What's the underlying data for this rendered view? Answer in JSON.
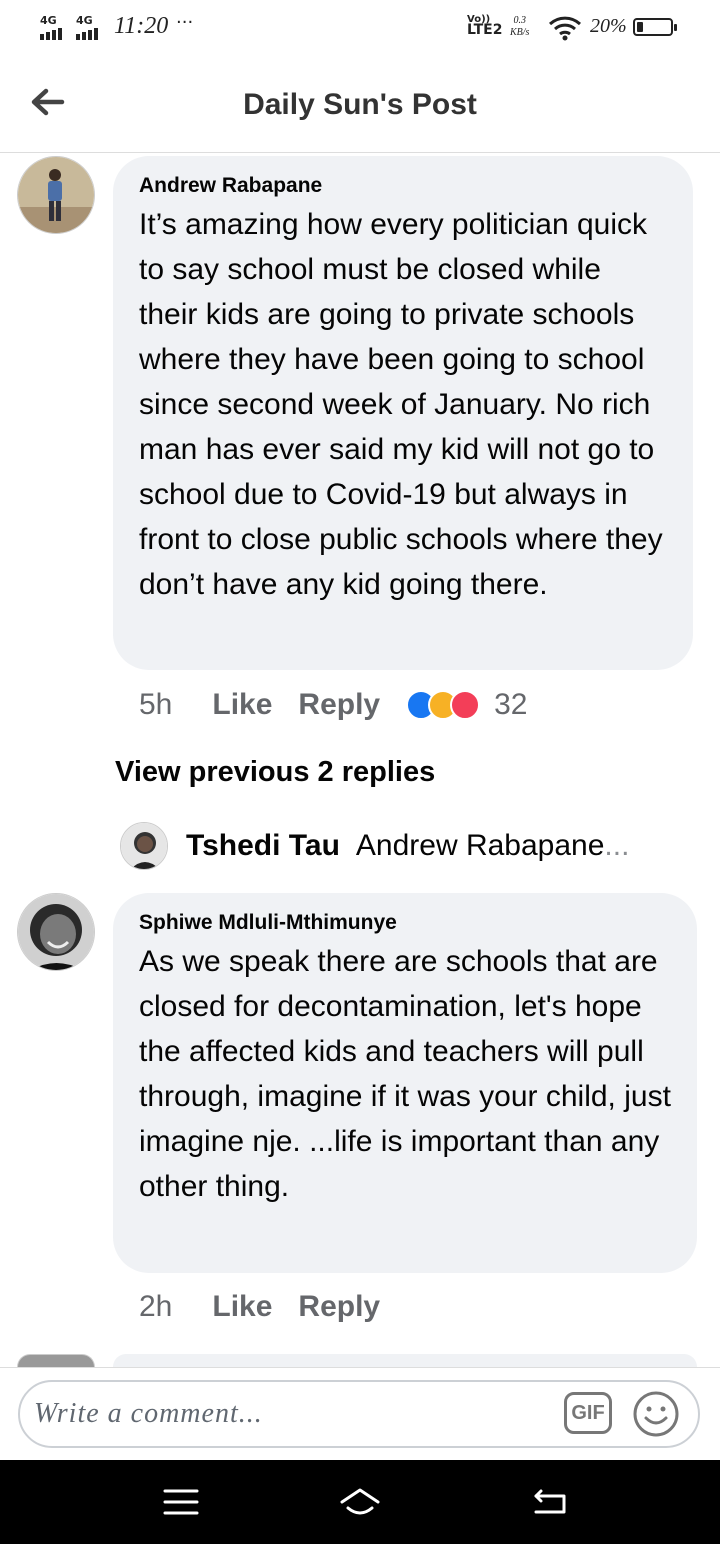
{
  "status_bar": {
    "network_1": "4G",
    "network_2": "4G",
    "time": "11:20",
    "more": "···",
    "volte_top": "Vo))",
    "volte_bottom": "LTE2",
    "speed_value": "0.3",
    "speed_unit": "KB/s",
    "battery_percent": "20%",
    "battery_level": 0.2
  },
  "header": {
    "title": "Daily Sun's Post",
    "back_icon": "arrow-left-icon"
  },
  "comments": [
    {
      "author": "Andrew Rabapane",
      "text": "It’s amazing how every politician quick to say school must be closed while their kids are going to private schools where they have been going to school since second week of January. No rich man has ever said my kid will not go to school due to Covid-19 but always in front to close public schools where they don’t have any kid going there.",
      "time": "5h",
      "like_label": "Like",
      "reply_label": "Reply",
      "reaction_icons": [
        "like-icon",
        "care-icon",
        "love-icon"
      ],
      "reaction_count": "32"
    },
    {
      "author": "Sphiwe Mdluli-Mthimunye",
      "text": "As we speak there are schools that are closed for decontamination, let's hope the affected kids and teachers will pull through,  imagine if it was your child, just imagine nje. ...life is important than any other thing.",
      "time": "2h",
      "like_label": "Like",
      "reply_label": "Reply"
    }
  ],
  "replies": {
    "view_previous": "View previous 2 replies",
    "latest_author": "Tshedi Tau",
    "latest_preview": "Andrew Rabapane",
    "ellipsis": "..."
  },
  "composer": {
    "placeholder": "Write a comment...",
    "gif_label": "GIF",
    "emoji_icon": "smiley-icon"
  },
  "nav": {
    "icons": [
      "menu-icon",
      "home-icon",
      "back-icon"
    ]
  },
  "colors": {
    "bubble": "#f0f2f5",
    "secondary_text": "#65676b",
    "like_blue": "#1877f2",
    "love_red": "#f33e58",
    "care_yellow": "#f7b125"
  }
}
